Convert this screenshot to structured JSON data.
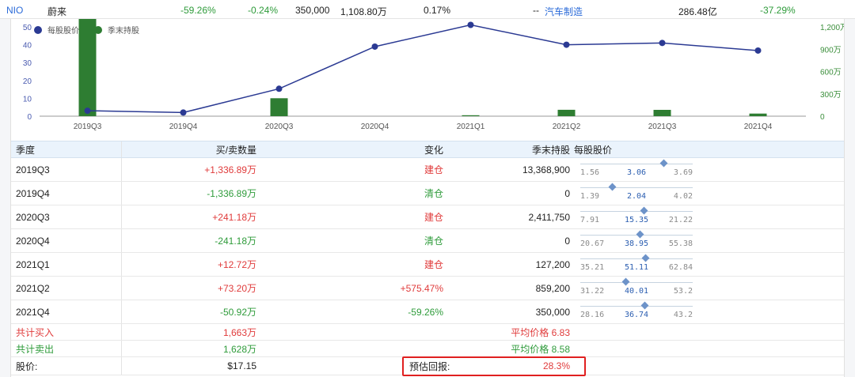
{
  "summary": {
    "ticker": "NIO",
    "name": "蔚来",
    "change_1": "-59.26%",
    "change_2": "-0.24%",
    "shares": "350,000",
    "value": "1,108.80万",
    "pct": "0.17%",
    "dash": "--",
    "industry": "汽车制造",
    "market_cap": "286.48亿",
    "return": "-37.29%"
  },
  "colors": {
    "price_line": "#2b3a93",
    "holding_bar": "#2e7d32",
    "up": "#e03b3b",
    "down": "#2e9b3a",
    "header_bg": "#eaf3fc"
  },
  "chart_data": {
    "type": "bar+line",
    "categories": [
      "2019Q3",
      "2019Q4",
      "2020Q3",
      "2020Q4",
      "2021Q1",
      "2021Q2",
      "2021Q3",
      "2021Q4"
    ],
    "series": [
      {
        "name": "每股股价",
        "type": "line",
        "axis": "left",
        "values": [
          3.06,
          2.04,
          15.35,
          38.95,
          51.11,
          40.01,
          41.0,
          36.74
        ]
      },
      {
        "name": "季末持股",
        "type": "bar",
        "axis": "right",
        "values": [
          13368900,
          0,
          2411750,
          0,
          127200,
          859200,
          850000,
          350000
        ]
      }
    ],
    "left_axis": {
      "ticks": [
        "0",
        "10",
        "20",
        "30",
        "40",
        "50"
      ],
      "range": [
        0,
        50
      ]
    },
    "right_axis": {
      "ticks": [
        "0",
        "300万",
        "600万",
        "900万",
        "1,200万"
      ],
      "range": [
        0,
        12000000
      ]
    },
    "legend": {
      "placement": "top-left",
      "labels": [
        "每股股价",
        "季末持股"
      ]
    }
  },
  "table": {
    "headers": {
      "quarter": "季度",
      "trade": "买/卖数量",
      "change": "变化",
      "holding": "季末持股",
      "price": "每股股价"
    },
    "rows": [
      {
        "quarter": "2019Q3",
        "trade": "+1,336.89万",
        "trade_dir": "up",
        "change": "建仓",
        "change_dir": "up",
        "holding": "13,368,900",
        "price_low": "1.56",
        "price_avg": "3.06",
        "price_high": "3.69",
        "marker_pos": 0.74
      },
      {
        "quarter": "2019Q4",
        "trade": "-1,336.89万",
        "trade_dir": "down",
        "change": "清仓",
        "change_dir": "down",
        "holding": "0",
        "price_low": "1.39",
        "price_avg": "2.04",
        "price_high": "4.02",
        "marker_pos": 0.28
      },
      {
        "quarter": "2020Q3",
        "trade": "+241.18万",
        "trade_dir": "up",
        "change": "建仓",
        "change_dir": "up",
        "holding": "2,411,750",
        "price_low": "7.91",
        "price_avg": "15.35",
        "price_high": "21.22",
        "marker_pos": 0.56
      },
      {
        "quarter": "2020Q4",
        "trade": "-241.18万",
        "trade_dir": "down",
        "change": "清仓",
        "change_dir": "down",
        "holding": "0",
        "price_low": "20.67",
        "price_avg": "38.95",
        "price_high": "55.38",
        "marker_pos": 0.53
      },
      {
        "quarter": "2021Q1",
        "trade": "+12.72万",
        "trade_dir": "up",
        "change": "建仓",
        "change_dir": "up",
        "holding": "127,200",
        "price_low": "35.21",
        "price_avg": "51.11",
        "price_high": "62.84",
        "marker_pos": 0.58
      },
      {
        "quarter": "2021Q2",
        "trade": "+73.20万",
        "trade_dir": "up",
        "change": "+575.47%",
        "change_dir": "up",
        "holding": "859,200",
        "price_low": "31.22",
        "price_avg": "40.01",
        "price_high": "53.2",
        "marker_pos": 0.4
      },
      {
        "quarter": "2021Q4",
        "trade": "-50.92万",
        "trade_dir": "down",
        "change": "-59.26%",
        "change_dir": "down",
        "holding": "350,000",
        "price_low": "28.16",
        "price_avg": "36.74",
        "price_high": "43.2",
        "marker_pos": 0.57
      }
    ],
    "total_buy": {
      "label": "共计买入",
      "value": "1,663万",
      "avg": "平均价格 6.83"
    },
    "total_sell": {
      "label": "共计卖出",
      "value": "1,628万",
      "avg": "平均价格 8.58"
    },
    "stock_price": {
      "label": "股价:",
      "value": "$17.15",
      "est_label": "预估回报:",
      "est_value": "28.3%"
    }
  }
}
